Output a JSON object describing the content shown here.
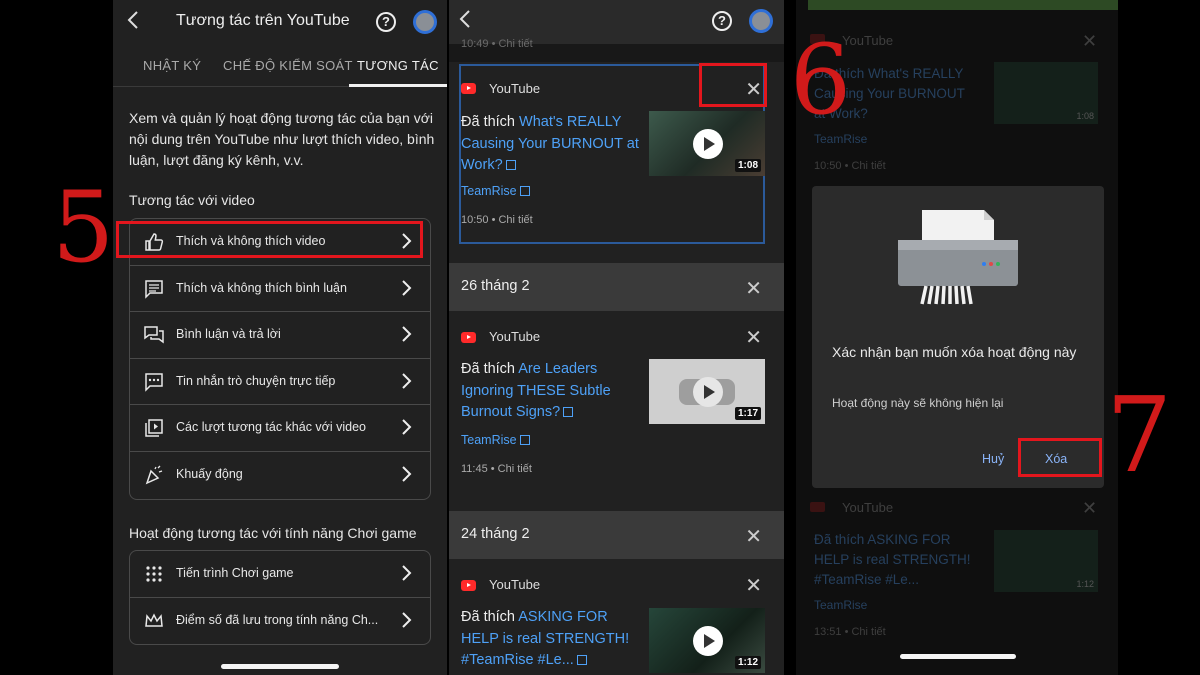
{
  "colors": {
    "accent_link": "#4ea1f7",
    "annotation_red": "#e3161d",
    "youtube_red": "#ff2a2a"
  },
  "panel1": {
    "title": "Tương tác trên YouTube",
    "help_glyph": "?",
    "tabs": [
      {
        "label": "NHẬT KÝ"
      },
      {
        "label": "CHẾ ĐỘ KIỂM SOÁT"
      },
      {
        "label": "TƯƠNG TÁC",
        "active": true
      }
    ],
    "description": "Xem và quản lý hoạt động tương tác của bạn với nội dung trên YouTube như lượt thích video, bình luận, lượt đăng ký kênh, v.v.",
    "section1_heading": "Tương tác với video",
    "section1_items": [
      {
        "label": "Thích và không thích video",
        "icon": "thumb-up-icon"
      },
      {
        "label": "Thích và không thích bình luận",
        "icon": "comment-icon"
      },
      {
        "label": "Bình luận và trả lời",
        "icon": "forum-icon"
      },
      {
        "label": "Tin nhắn trò chuyện trực tiếp",
        "icon": "chat-icon"
      },
      {
        "label": "Các lượt tương tác khác với video",
        "icon": "video-library-icon"
      },
      {
        "label": "Khuấy động",
        "icon": "party-icon"
      }
    ],
    "section2_heading": "Hoạt động tương tác với tính năng Chơi game",
    "section2_items": [
      {
        "label": "Tiến trình Chơi game",
        "icon": "progress-dots-icon"
      },
      {
        "label": "Điểm số đã lưu trong tính năng Ch...",
        "icon": "crown-icon"
      }
    ]
  },
  "panel2": {
    "top_faint": "10:49 • Chi tiết",
    "cards": [
      {
        "source": "YouTube",
        "prefix": "Đã thích ",
        "link": "What's REALLY Causing Your BURNOUT at Work?",
        "channel": "TeamRise",
        "time": "10:50 • Chi tiết",
        "duration": "1:08"
      },
      {
        "date": "26 tháng 2",
        "source": "YouTube",
        "prefix": "Đã thích ",
        "link": "Are Leaders Ignoring THESE Subtle Burnout Signs?",
        "channel": "TeamRise",
        "time": "11:45 • Chi tiết",
        "duration": "1:17"
      },
      {
        "date": "24 tháng 2",
        "source": "YouTube",
        "prefix": "Đã thích ",
        "link": "ASKING FOR HELP is real STRENGTH! #TeamRise #Le...",
        "duration": "1:12"
      }
    ]
  },
  "panel3": {
    "bg_card1": {
      "source": "YouTube",
      "text": "Đã thích What's REALLY Causing Your BURNOUT at Work?",
      "channel": "TeamRise",
      "time": "10:50 • Chi tiết",
      "duration": "1:08"
    },
    "bg_card2": {
      "source": "YouTube",
      "text": "Đã thích ASKING FOR HELP is real STRENGTH! #TeamRise #Le...",
      "channel": "TeamRise",
      "time": "13:51 • Chi tiết",
      "duration": "1:12"
    },
    "dialog": {
      "title": "Xác nhận bạn muốn xóa hoạt động này",
      "body": "Hoạt động này sẽ không hiện lại",
      "cancel": "Huỷ",
      "delete": "Xóa"
    }
  },
  "annotations": {
    "step5": "5",
    "step6": "6",
    "step7": "7"
  }
}
